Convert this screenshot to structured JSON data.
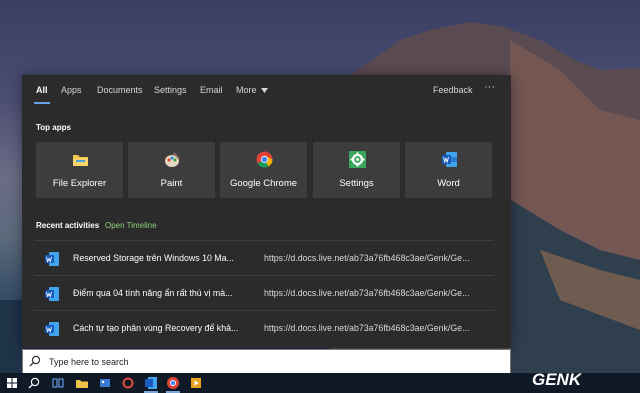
{
  "tabs": [
    {
      "label": "All",
      "active": true
    },
    {
      "label": "Apps"
    },
    {
      "label": "Documents"
    },
    {
      "label": "Settings"
    },
    {
      "label": "Email"
    },
    {
      "label": "More"
    }
  ],
  "header": {
    "feedback_label": "Feedback",
    "more_options_icon": "ellipsis-icon"
  },
  "top_apps": {
    "title": "Top apps",
    "apps": [
      {
        "label": "File Explorer",
        "icon": "folder-icon"
      },
      {
        "label": "Paint",
        "icon": "paint-palette-icon"
      },
      {
        "label": "Google Chrome",
        "icon": "chrome-icon"
      },
      {
        "label": "Settings",
        "icon": "gear-icon"
      },
      {
        "label": "Word",
        "icon": "word-icon"
      }
    ]
  },
  "recent": {
    "title": "Recent activities",
    "open_timeline_label": "Open Timeline",
    "items": [
      {
        "title": "Reserved Storage trên Windows 10 Ma...",
        "url": "https://d.docs.live.net/ab73a76fb468c3ae/Genk/Ge..."
      },
      {
        "title": "Điểm qua 04 tính năng ẩn rất thú vị mà...",
        "url": "https://d.docs.live.net/ab73a76fb468c3ae/Genk/Ge..."
      },
      {
        "title": "Cách tự tạo phân vùng Recovery để khả...",
        "url": "https://d.docs.live.net/ab73a76fb468c3ae/Genk/Ge..."
      }
    ]
  },
  "search": {
    "placeholder": "Type here to search"
  },
  "watermark": {
    "text": "GENK"
  },
  "colors": {
    "accent": "#6aa2e8",
    "link_green": "#8fd47a",
    "panel_bg": "#2b2b2b",
    "tile_bg": "#3d3d3d"
  }
}
